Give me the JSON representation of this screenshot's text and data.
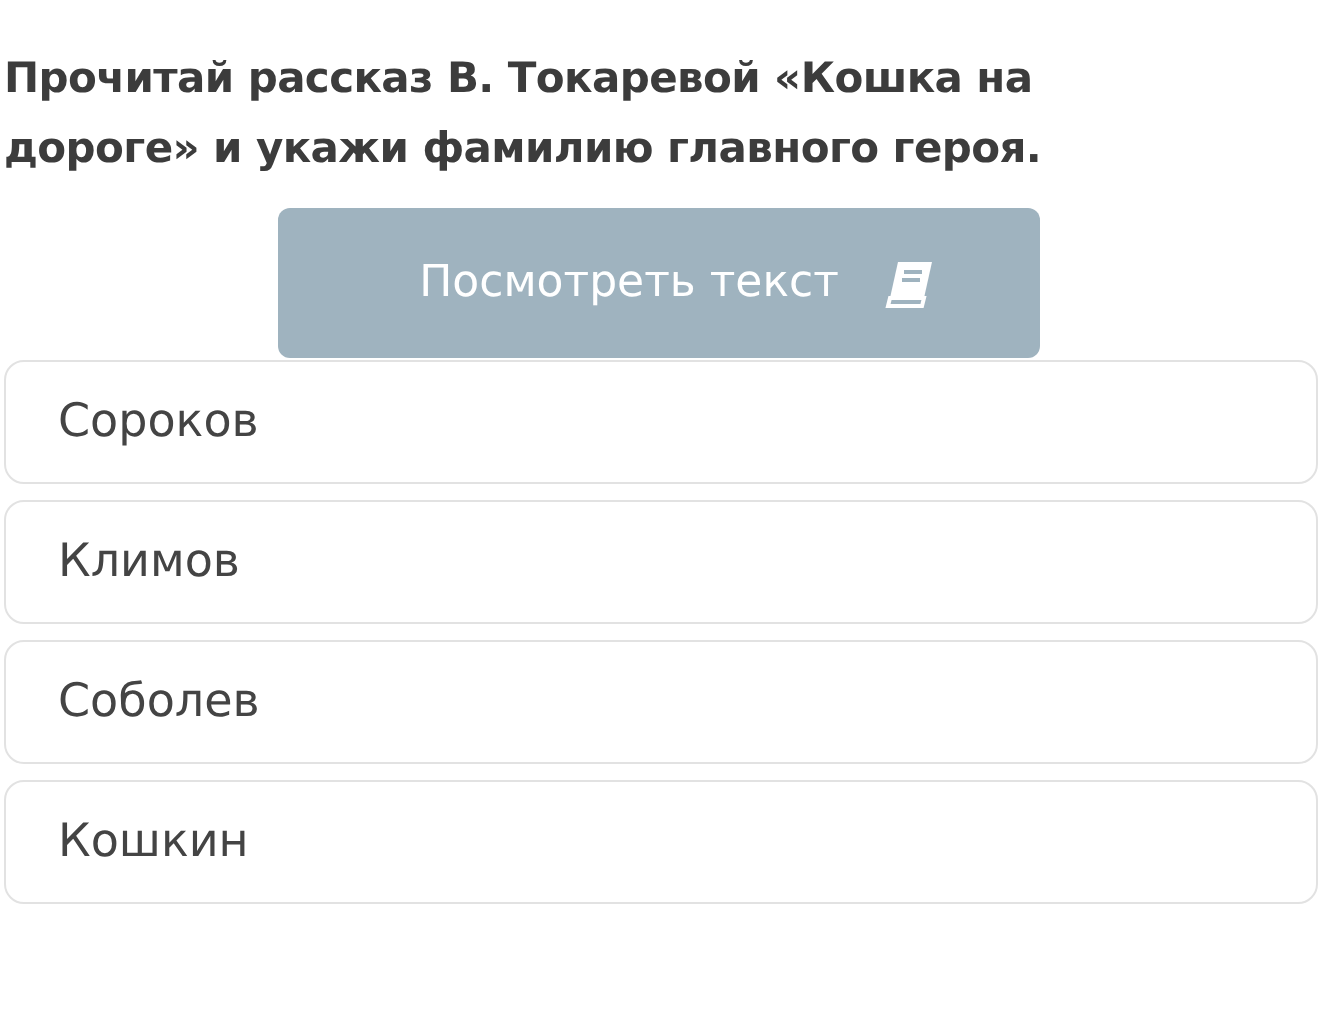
{
  "question": "Прочитай рассказ В. Токаревой «Кошка на дороге» и укажи фамилию главного героя.",
  "view_button": {
    "label": "Посмотреть текст"
  },
  "options": [
    "Сороков",
    "Климов",
    "Соболев",
    "Кошкин"
  ]
}
